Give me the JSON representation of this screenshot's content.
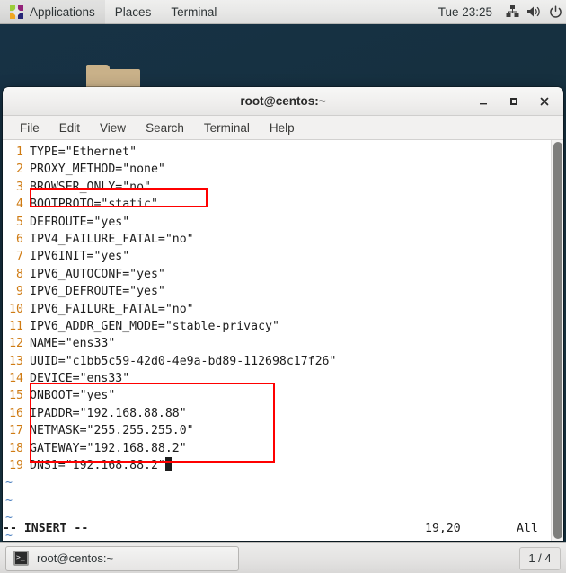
{
  "top_panel": {
    "applications_label": "Applications",
    "places_label": "Places",
    "terminal_label": "Terminal",
    "clock": "Tue 23:25",
    "tray": {
      "network_icon": "network-icon",
      "volume_icon": "volume-icon",
      "power_icon": "power-icon"
    }
  },
  "desktop": {
    "folder_icon": "folder-icon",
    "background_color": "#16303f"
  },
  "window": {
    "title": "root@centos:~",
    "buttons": {
      "minimize": "minimize-icon",
      "maximize": "maximize-icon",
      "close": "close-icon"
    },
    "menu": [
      {
        "label": "File"
      },
      {
        "label": "Edit"
      },
      {
        "label": "View"
      },
      {
        "label": "Search"
      },
      {
        "label": "Terminal"
      },
      {
        "label": "Help"
      }
    ]
  },
  "editor": {
    "lines": [
      {
        "n": "1",
        "text": "TYPE=\"Ethernet\""
      },
      {
        "n": "2",
        "text": "PROXY_METHOD=\"none\""
      },
      {
        "n": "3",
        "text": "BROWSER_ONLY=\"no\""
      },
      {
        "n": "4",
        "text": "BOOTPROTO=\"static\""
      },
      {
        "n": "5",
        "text": "DEFROUTE=\"yes\""
      },
      {
        "n": "6",
        "text": "IPV4_FAILURE_FATAL=\"no\""
      },
      {
        "n": "7",
        "text": "IPV6INIT=\"yes\""
      },
      {
        "n": "8",
        "text": "IPV6_AUTOCONF=\"yes\""
      },
      {
        "n": "9",
        "text": "IPV6_DEFROUTE=\"yes\""
      },
      {
        "n": "10",
        "text": "IPV6_FAILURE_FATAL=\"no\""
      },
      {
        "n": "11",
        "text": "IPV6_ADDR_GEN_MODE=\"stable-privacy\""
      },
      {
        "n": "12",
        "text": "NAME=\"ens33\""
      },
      {
        "n": "13",
        "text": "UUID=\"c1bb5c59-42d0-4e9a-bd89-112698c17f26\""
      },
      {
        "n": "14",
        "text": "DEVICE=\"ens33\""
      },
      {
        "n": "15",
        "text": "ONBOOT=\"yes\""
      },
      {
        "n": "16",
        "text": "IPADDR=\"192.168.88.88\""
      },
      {
        "n": "17",
        "text": "NETMASK=\"255.255.255.0\""
      },
      {
        "n": "18",
        "text": "GATEWAY=\"192.168.88.2\""
      },
      {
        "n": "19",
        "text": "DNS1=\"192.168.88.2\""
      }
    ],
    "empty_markers": [
      "~",
      "~",
      "~",
      "~"
    ],
    "status": {
      "mode": "-- INSERT --",
      "position": "19,20",
      "scroll": "All"
    },
    "annotation_color": "#ff0000",
    "lineno_color": "#cf7b13",
    "tilde_color": "#4b7fbf"
  },
  "taskbar": {
    "window_button_label": "root@centos:~",
    "window_button_icon": "terminal-icon",
    "workspace_indicator": "1 / 4"
  }
}
